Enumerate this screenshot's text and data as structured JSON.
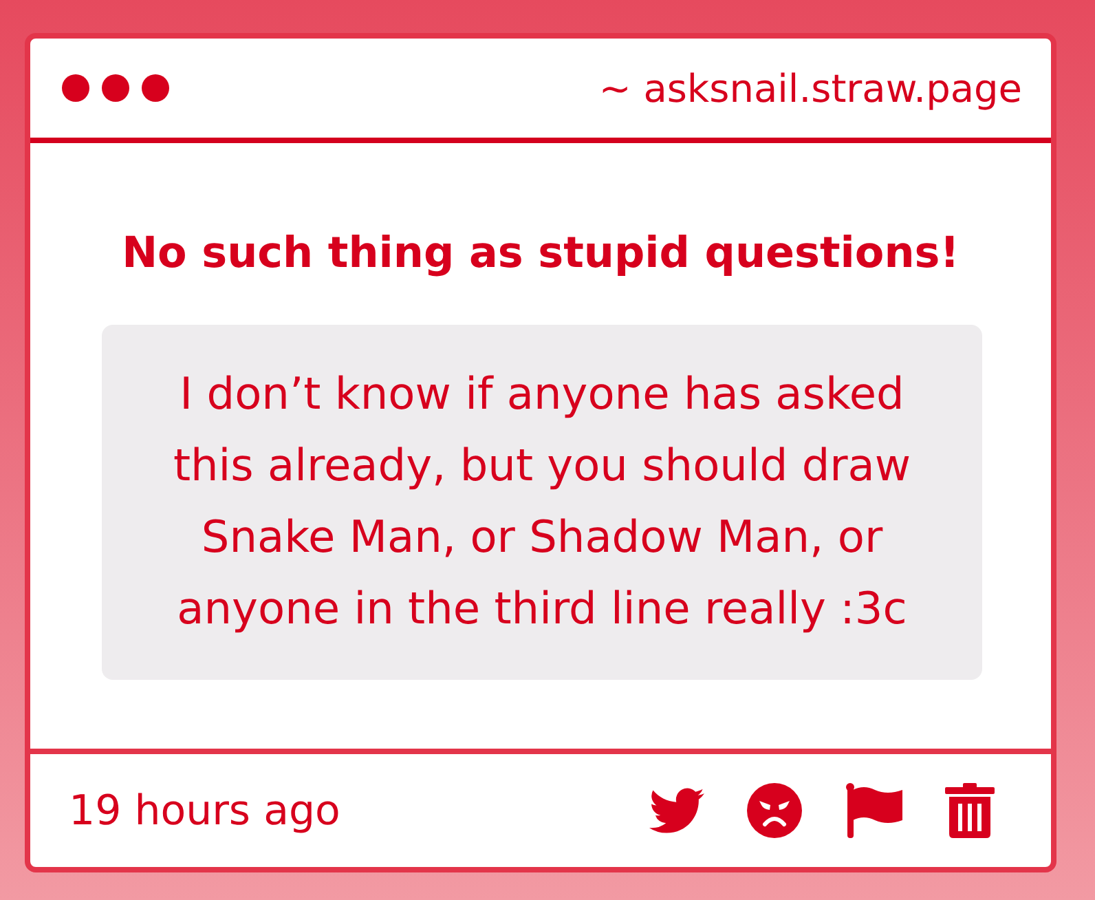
{
  "header": {
    "url": "~ asksnail.straw.page"
  },
  "title": "No such thing as stupid questions!",
  "question": {
    "text": "I don’t know if anyone has asked this already, but you should draw Snake Man, or Shadow Man, or anyone in the third line really :3c"
  },
  "footer": {
    "time": "19 hours ago"
  }
}
